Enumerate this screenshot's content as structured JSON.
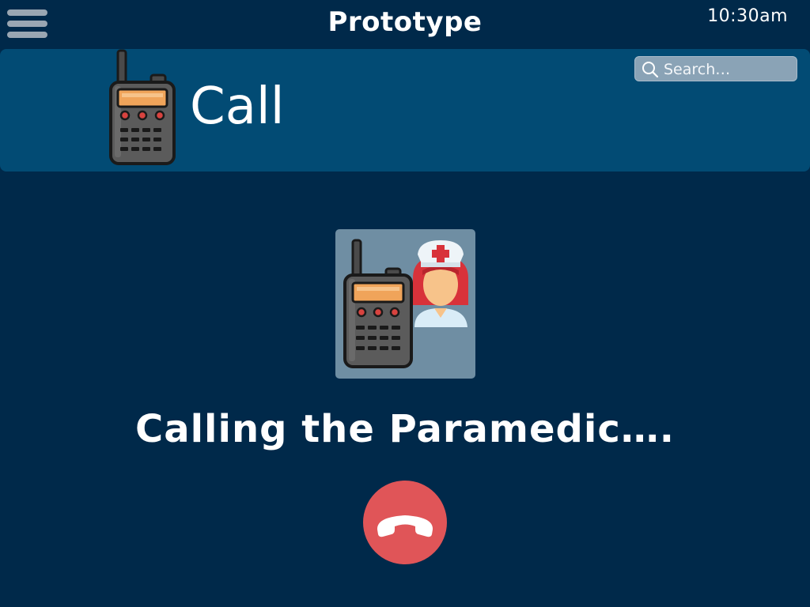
{
  "app": {
    "title": "Prototype",
    "clock": "10:30am"
  },
  "header": {
    "title": "Call",
    "icon": "walkie-talkie-icon"
  },
  "search": {
    "placeholder": "Search…",
    "value": ""
  },
  "call": {
    "status": "Calling the Paramedic….",
    "contact_icons": [
      "walkie-talkie-icon",
      "paramedic-nurse-icon"
    ],
    "hangup_icon": "phone-hangup-icon"
  },
  "colors": {
    "background": "#00294a",
    "header_band": "#024b74",
    "search_bg": "#8aa3b6",
    "avatar_bg": "#6f8ea3",
    "hangup": "#e05558",
    "text": "#ffffff"
  }
}
